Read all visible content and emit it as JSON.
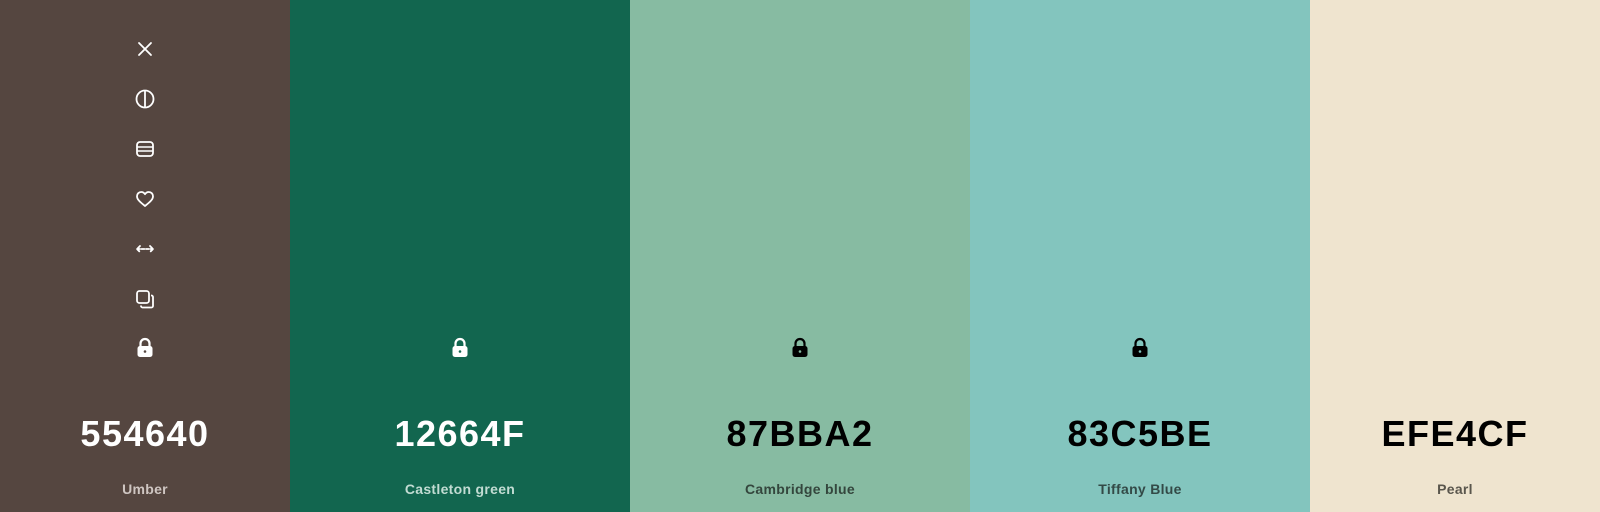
{
  "palette": {
    "swatches": [
      {
        "hex": "554640",
        "name": "Umber",
        "color": "#554640",
        "text_color": "#ffffff",
        "name_color": "#cfc6c2",
        "icon_color": "#ffffff",
        "locked": true
      },
      {
        "hex": "12664F",
        "name": "Castleton green",
        "color": "#12664F",
        "text_color": "#ffffff",
        "name_color": "#c2dcd3",
        "icon_color": "#ffffff",
        "locked": true
      },
      {
        "hex": "87BBA2",
        "name": "Cambridge blue",
        "color": "#87BBA2",
        "text_color": "#000000",
        "name_color": "#34463d",
        "icon_color": "#000000",
        "locked": true
      },
      {
        "hex": "83C5BE",
        "name": "Tiffany Blue",
        "color": "#83C5BE",
        "text_color": "#000000",
        "name_color": "#334a47",
        "icon_color": "#000000",
        "locked": true
      },
      {
        "hex": "EFE4CF",
        "name": "Pearl",
        "color": "#EFE4CF",
        "text_color": "#000000",
        "name_color": "#5a564d",
        "icon_color": "#000000",
        "locked": false
      }
    ],
    "toolbar_icons": [
      "close-icon",
      "contrast-icon",
      "shades-icon",
      "heart-icon",
      "drag-arrows-icon",
      "copy-icon"
    ]
  }
}
